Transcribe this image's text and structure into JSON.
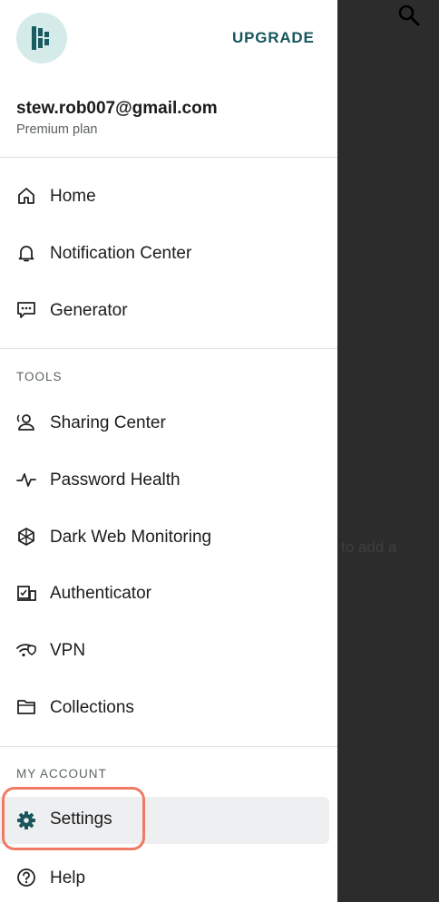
{
  "header": {
    "upgrade_label": "UPGRADE"
  },
  "account": {
    "email": "stew.rob007@gmail.com",
    "plan": "Premium plan"
  },
  "nav": {
    "items": [
      {
        "label": "Home",
        "icon": "home-icon"
      },
      {
        "label": "Notification Center",
        "icon": "bell-icon"
      },
      {
        "label": "Generator",
        "icon": "generator-icon"
      }
    ]
  },
  "tools": {
    "title": "TOOLS",
    "items": [
      {
        "label": "Sharing Center",
        "icon": "sharing-icon"
      },
      {
        "label": "Password Health",
        "icon": "pulse-icon"
      },
      {
        "label": "Dark Web Monitoring",
        "icon": "dark-web-icon"
      },
      {
        "label": "Authenticator",
        "icon": "authenticator-icon"
      },
      {
        "label": "VPN",
        "icon": "vpn-icon"
      },
      {
        "label": "Collections",
        "icon": "folder-icon"
      }
    ]
  },
  "my_account": {
    "title": "MY ACCOUNT",
    "items": [
      {
        "label": "Settings",
        "icon": "gear-icon",
        "selected": true
      },
      {
        "label": "Help",
        "icon": "help-icon"
      }
    ]
  },
  "background": {
    "partial_text": "to add a"
  },
  "colors": {
    "accent": "#18565c",
    "highlight": "#f07a63",
    "logo_bg": "#d5ebea",
    "scrim": "#2b2c2b"
  }
}
